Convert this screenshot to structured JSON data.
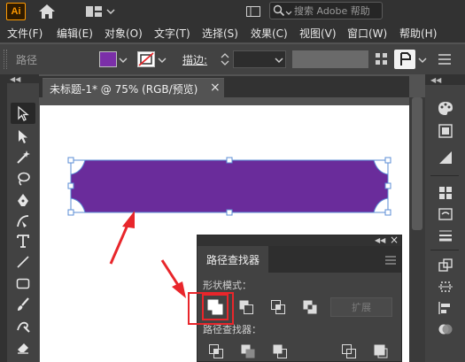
{
  "app": {
    "logo": "Ai",
    "accent": "#ff9a00",
    "bg": "#2f1b00"
  },
  "search": {
    "placeholder": "搜索 Adobe 帮助"
  },
  "menu": [
    "文件(F)",
    "编辑(E)",
    "对象(O)",
    "文字(T)",
    "选择(S)",
    "效果(C)",
    "视图(V)",
    "窗口(W)",
    "帮助(H)"
  ],
  "control": {
    "selection_label": "路径",
    "fill_color": "#7b2fa8",
    "stroke_label": "描边",
    "stroke_colon": ":"
  },
  "document": {
    "tab_title": "未标题-1* @ 75% (RGB/预览)",
    "close": "×"
  },
  "shape": {
    "fill": "#6a2c9b",
    "stroke": "#5b8dd6"
  },
  "annotation": {
    "arrow_color": "#e8262b",
    "highlight_color": "#e8262b"
  },
  "pathfinder": {
    "tab": "路径查找器",
    "shape_modes_label": "形状模式：",
    "expand_label": "扩展",
    "pathfinders_label": "路径查找器："
  },
  "icons": {
    "home": "home-icon",
    "search": "search-icon",
    "selection": "selection-tool-icon",
    "direct": "direct-selection-tool-icon",
    "unite": "unite-icon",
    "minus_front": "minus-front-icon",
    "intersect": "intersect-icon",
    "exclude": "exclude-icon"
  }
}
